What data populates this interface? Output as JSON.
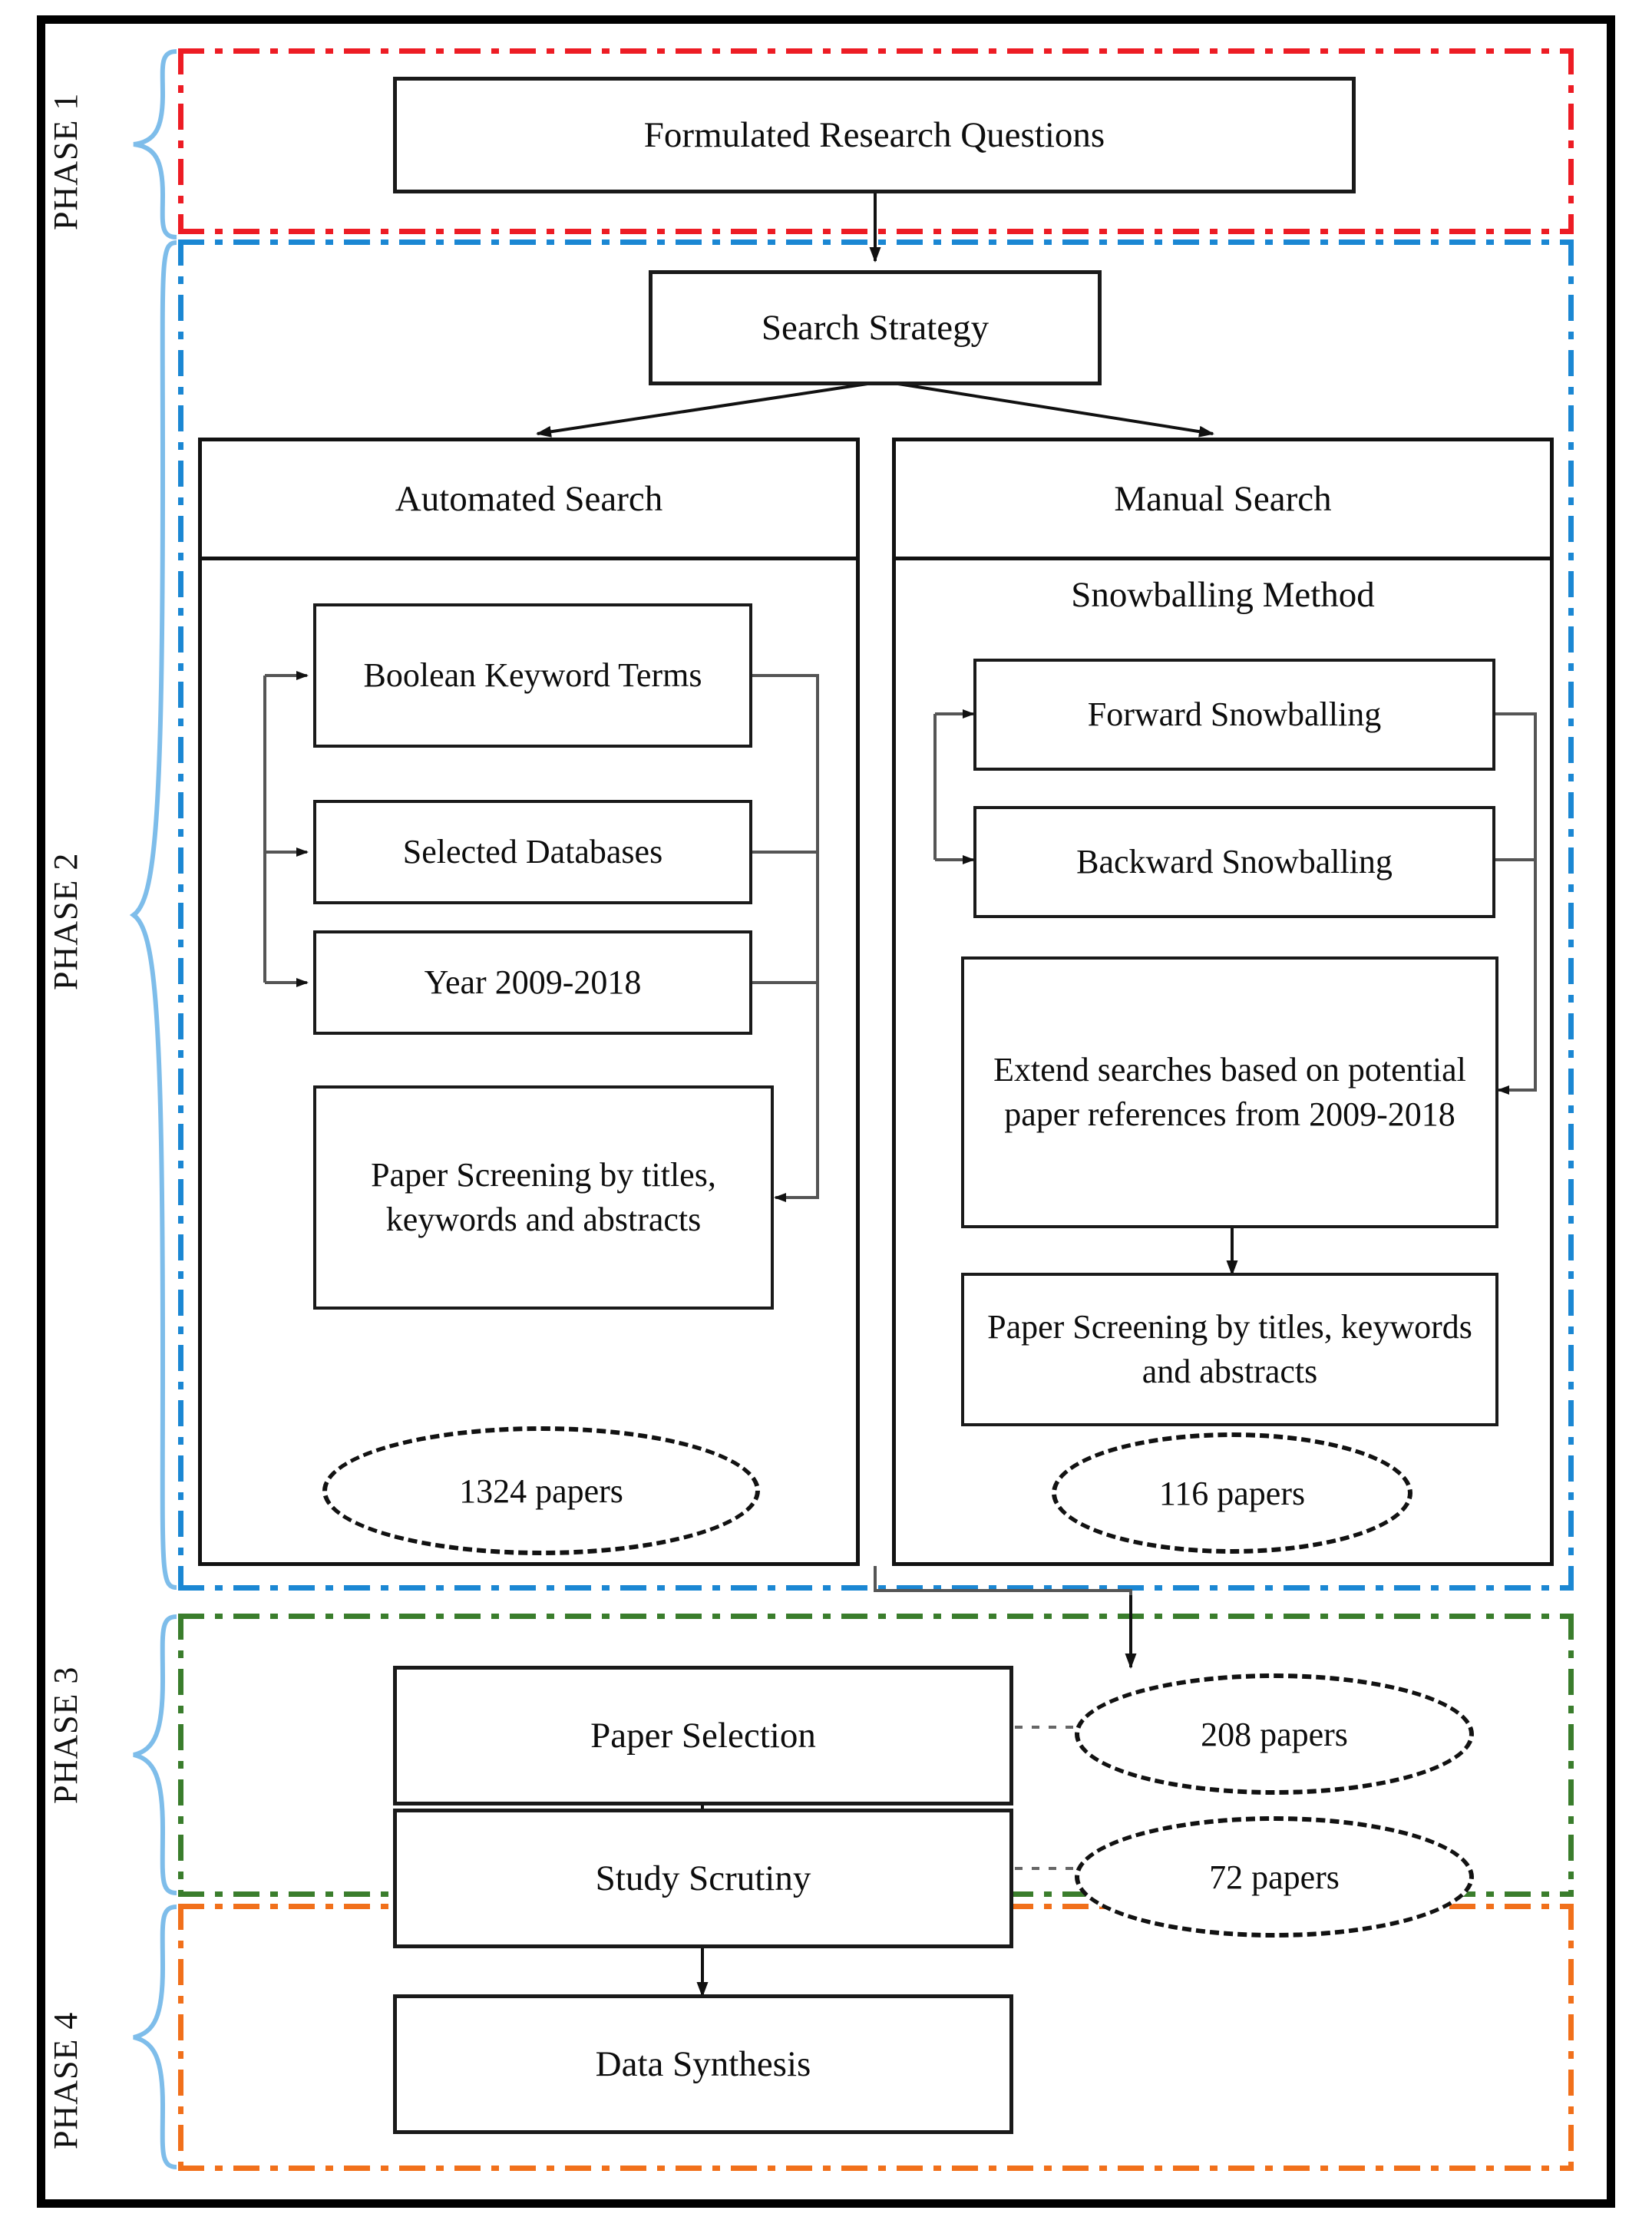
{
  "figure": {
    "type": "flowchart",
    "description": "Systematic literature review process flow diagram organized in four phases"
  },
  "phases": [
    {
      "id": "phase1",
      "label": "PHASE 1",
      "color": "#ED1C24"
    },
    {
      "id": "phase2",
      "label": "PHASE 2",
      "color": "#1B87D3"
    },
    {
      "id": "phase3",
      "label": "PHASE 3",
      "color": "#3A7D2C"
    },
    {
      "id": "phase4",
      "label": "PHASE 4",
      "color": "#F1701B"
    }
  ],
  "phase1": {
    "research_questions": "Formulated Research Questions"
  },
  "phase2": {
    "search_strategy": "Search Strategy",
    "automated": {
      "header": "Automated Search",
      "boolean_terms": "Boolean Keyword Terms",
      "databases": "Selected Databases",
      "year_range": "Year 2009-2018",
      "screening": "Paper Screening by titles, keywords and abstracts",
      "result": "1324 papers"
    },
    "manual": {
      "header": "Manual Search",
      "method": "Snowballing Method",
      "forward": "Forward Snowballing",
      "backward": "Backward Snowballing",
      "extend": "Extend searches based on potential paper references from 2009-2018",
      "screening": "Paper Screening by titles, keywords and abstracts",
      "result": "116 papers"
    }
  },
  "phase3": {
    "paper_selection": "Paper Selection",
    "paper_selection_result": "208 papers",
    "study_scrutiny": "Study Scrutiny",
    "study_scrutiny_result": "72 papers"
  },
  "phase4": {
    "data_synthesis": "Data Synthesis"
  },
  "colors": {
    "phase1_border": "#ED1C24",
    "phase2_border": "#1B87D3",
    "phase3_border": "#3A7D2C",
    "phase4_border": "#F1701B",
    "brace": "#7EBDEA",
    "node_border": "#121212",
    "text": "#0d0d0d"
  }
}
